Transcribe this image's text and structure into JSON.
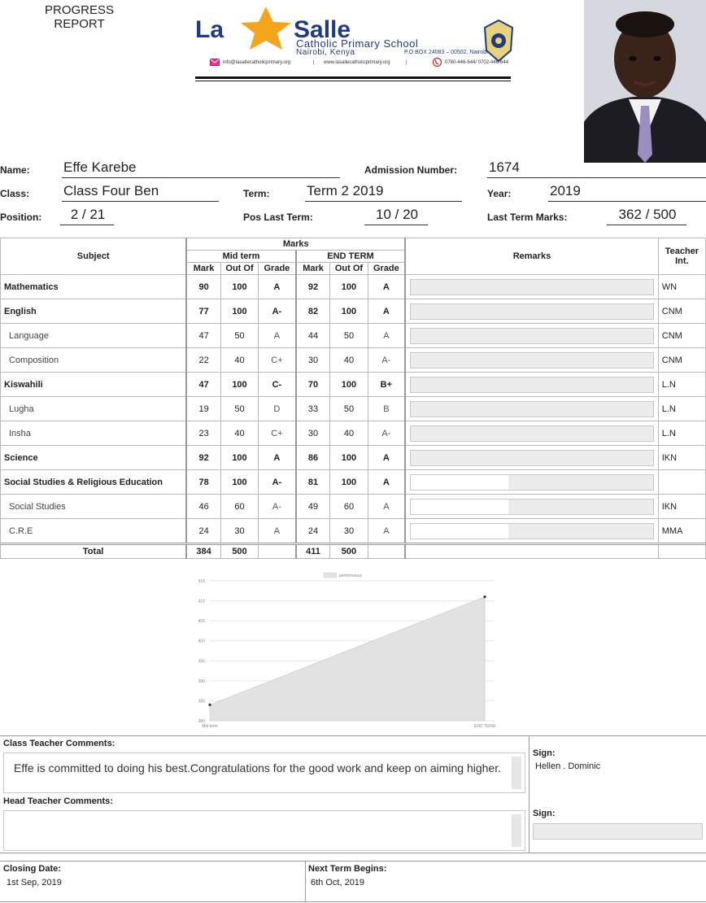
{
  "header": {
    "report_title_line1": "PROGRESS",
    "report_title_line2": "REPORT",
    "school_word1": "La",
    "school_word2": "Salle",
    "school_subtitle": "Catholic Primary School",
    "school_location": "Nairobi, Kenya",
    "school_box": "P.O BOX 24083 – 00502, Nairobi",
    "email": "info@lasallecatholicprimary.org",
    "website": "www.lasallecatholicprimary.org",
    "phone": "0780-446-644/ 0702-446-644",
    "brand_blue": "#1f3b82",
    "star_orange": "#f5a51c"
  },
  "student": {
    "name_label": "Name:",
    "name": "Effe Karebe",
    "admission_label": "Admission Number:",
    "admission": "1674",
    "class_label": "Class:",
    "class": "Class Four Ben",
    "term_label": "Term:",
    "term": "Term 2 2019",
    "year_label": "Year:",
    "year": "2019",
    "position_label": "Position:",
    "position": "2 / 21",
    "pos_last_label": "Pos Last Term:",
    "pos_last": "10 / 20",
    "last_marks_label": "Last Term Marks:",
    "last_marks": "362 / 500"
  },
  "table": {
    "h_subject": "Subject",
    "h_marks": "Marks",
    "h_mid": "Mid term",
    "h_end": "END TERM",
    "h_mark": "Mark",
    "h_outof": "Out Of",
    "h_grade": "Grade",
    "h_remarks": "Remarks",
    "h_teacher": "Teacher Int.",
    "rows": [
      {
        "subject": "Mathematics",
        "mid_mark": "90",
        "mid_out": "100",
        "mid_grade": "A",
        "end_mark": "92",
        "end_out": "100",
        "end_grade": "A",
        "teacher": "WN"
      },
      {
        "subject": "English",
        "mid_mark": "77",
        "mid_out": "100",
        "mid_grade": "A-",
        "end_mark": "82",
        "end_out": "100",
        "end_grade": "A",
        "teacher": "CNM"
      },
      {
        "subject": "Language",
        "mid_mark": "47",
        "mid_out": "50",
        "mid_grade": "A",
        "end_mark": "44",
        "end_out": "50",
        "end_grade": "A",
        "teacher": "CNM"
      },
      {
        "subject": "Composition",
        "mid_mark": "22",
        "mid_out": "40",
        "mid_grade": "C+",
        "end_mark": "30",
        "end_out": "40",
        "end_grade": "A-",
        "teacher": "CNM"
      },
      {
        "subject": "Kiswahili",
        "mid_mark": "47",
        "mid_out": "100",
        "mid_grade": "C-",
        "end_mark": "70",
        "end_out": "100",
        "end_grade": "B+",
        "teacher": "L.N"
      },
      {
        "subject": "Lugha",
        "mid_mark": "19",
        "mid_out": "50",
        "mid_grade": "D",
        "end_mark": "33",
        "end_out": "50",
        "end_grade": "B",
        "teacher": "L.N"
      },
      {
        "subject": "Insha",
        "mid_mark": "23",
        "mid_out": "40",
        "mid_grade": "C+",
        "end_mark": "30",
        "end_out": "40",
        "end_grade": "A-",
        "teacher": "L.N"
      },
      {
        "subject": "Science",
        "mid_mark": "92",
        "mid_out": "100",
        "mid_grade": "A",
        "end_mark": "86",
        "end_out": "100",
        "end_grade": "A",
        "teacher": "IKN"
      },
      {
        "subject": "Social Studies & Religious Education",
        "mid_mark": "78",
        "mid_out": "100",
        "mid_grade": "A-",
        "end_mark": "81",
        "end_out": "100",
        "end_grade": "A",
        "teacher": ""
      },
      {
        "subject": "Social Studies",
        "mid_mark": "46",
        "mid_out": "60",
        "mid_grade": "A-",
        "end_mark": "49",
        "end_out": "60",
        "end_grade": "A",
        "teacher": "IKN"
      },
      {
        "subject": "C.R.E",
        "mid_mark": "24",
        "mid_out": "30",
        "mid_grade": "A",
        "end_mark": "24",
        "end_out": "30",
        "end_grade": "A",
        "teacher": "MMA"
      }
    ],
    "total_label": "Total",
    "total_mid_mark": "384",
    "total_mid_out": "500",
    "total_end_mark": "411",
    "total_end_out": "500"
  },
  "chart_data": {
    "type": "area",
    "categories": [
      "Mid term",
      "END TERM"
    ],
    "series": [
      {
        "name": "performance",
        "values": [
          384,
          411
        ]
      }
    ],
    "yticks": [
      "380",
      "385",
      "390",
      "395",
      "400",
      "405",
      "410",
      "415"
    ],
    "ylim": [
      380,
      415
    ],
    "grid": true,
    "legend": "top"
  },
  "comments": {
    "class_teacher_label": "Class Teacher Comments:",
    "class_teacher_text": "Effe is committed to doing his best.Congratulations for the good work and keep on aiming higher.",
    "head_teacher_label": "Head Teacher Comments:",
    "head_teacher_text": "",
    "sign_label": "Sign:",
    "class_teacher_sign": "Hellen . Dominic",
    "head_sign_label": "Sign:"
  },
  "footer": {
    "closing_label": "Closing Date:",
    "closing": "1st Sep, 2019",
    "next_label": "Next Term Begins:",
    "next": "6th Oct, 2019"
  }
}
